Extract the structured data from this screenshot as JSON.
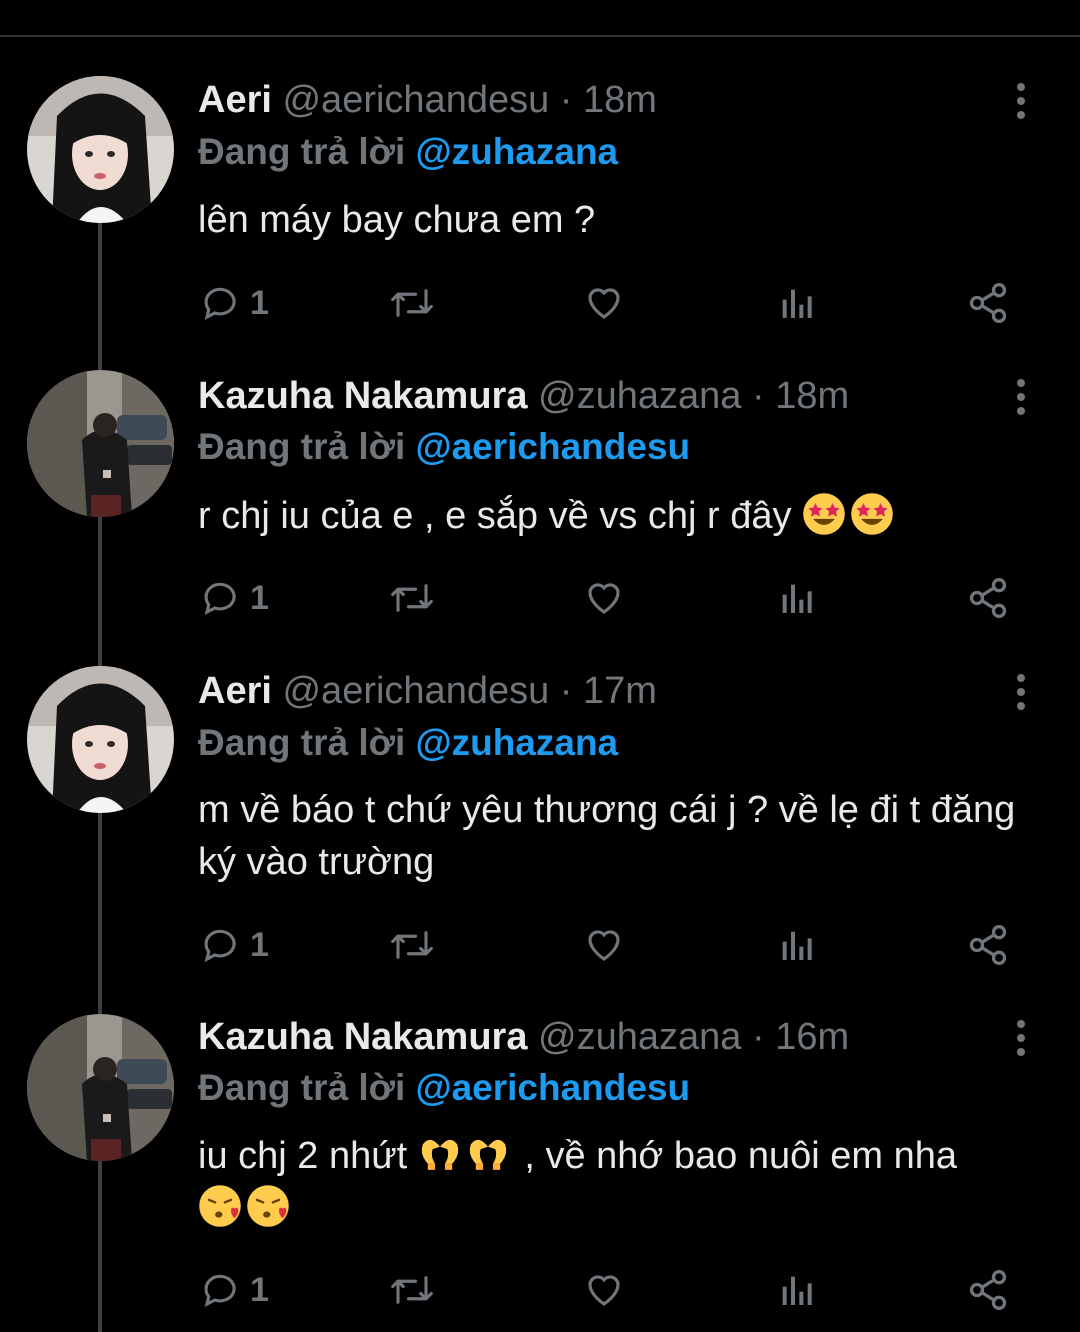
{
  "tweets": [
    {
      "name": "Aeri",
      "handle": "@aerichandesu",
      "separator": "·",
      "time": "18m",
      "reply_label": "Đang trả lời",
      "reply_to": "@zuhazana",
      "text": "lên máy bay chưa em ?",
      "text_tail": "",
      "reply_count": "1",
      "avatar": "aeri-portrait"
    },
    {
      "name": "Kazuha Nakamura",
      "handle": "@zuhazana",
      "separator": "·",
      "time": "18m",
      "reply_label": "Đang trả lời",
      "reply_to": "@aerichandesu",
      "text": "r chj iu của e , e sắp về vs chj r đây",
      "text_tail": "",
      "emojis": [
        "star-struck-emoji",
        "star-struck-emoji"
      ],
      "reply_count": "1",
      "avatar": "kazuha-street-photo"
    },
    {
      "name": "Aeri",
      "handle": "@aerichandesu",
      "separator": "·",
      "time": "17m",
      "reply_label": "Đang trả lời",
      "reply_to": "@zuhazana",
      "text": "m về báo t chứ yêu thương cái j ? về lẹ đi t đăng ký vào trường",
      "text_tail": "",
      "reply_count": "1",
      "avatar": "aeri-portrait"
    },
    {
      "name": "Kazuha Nakamura",
      "handle": "@zuhazana",
      "separator": "·",
      "time": "16m",
      "reply_label": "Đang trả lời",
      "reply_to": "@aerichandesu",
      "text": "iu chj 2 nhứt",
      "text_tail": " , về nhớ bao nuôi em nha",
      "emojis": [
        "heart-hands-emoji",
        "heart-hands-emoji",
        "kissing-heart-emoji",
        "kissing-heart-emoji"
      ],
      "reply_count": "1",
      "avatar": "kazuha-street-photo"
    }
  ],
  "icons": {
    "reply": "reply-icon",
    "retweet": "retweet-icon",
    "like": "heart-icon",
    "analytics": "analytics-icon",
    "share": "share-icon",
    "more": "more-vertical-icon"
  },
  "colors": {
    "background": "#000000",
    "muted": "#71767b",
    "mention": "#1d9bf0",
    "text": "#e7e9ea"
  }
}
